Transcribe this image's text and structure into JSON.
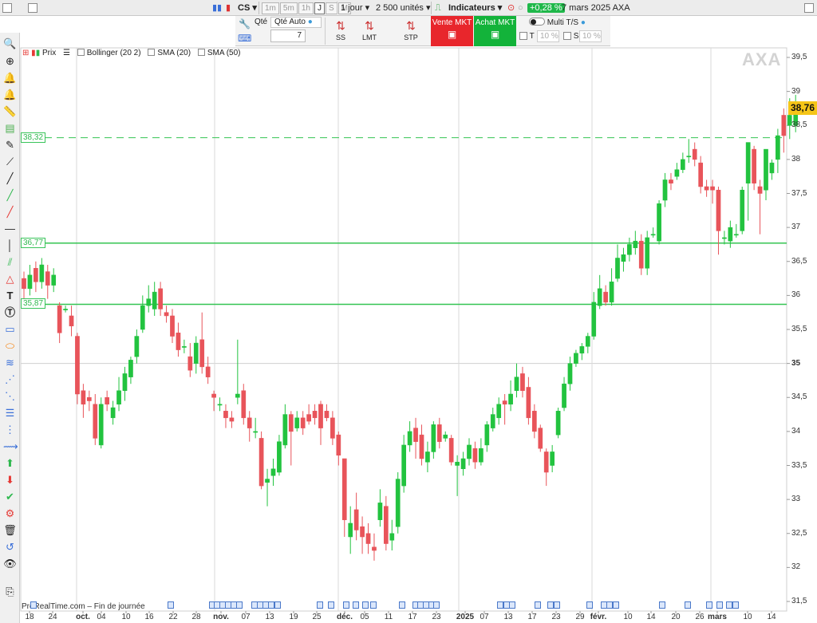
{
  "toolbar": {
    "instrument_code": "CS",
    "timeframes": [
      "1m",
      "5m",
      "1h",
      "J",
      "S",
      "M"
    ],
    "active_timeframe": "J",
    "period": "1 jour",
    "units": "2 500 unités",
    "indicators_label": "Indicateurs",
    "change": "+0,28 %",
    "date_instrument": "7 mars 2025 AXA"
  },
  "order_panel": {
    "qty_label": "Qté",
    "qty_auto": "Qté Auto",
    "qty_value": "7",
    "order_types": [
      "SS",
      "LMT",
      "STP"
    ],
    "sell_label": "Vente MKT",
    "buy_label": "Achat MKT",
    "multi_label": "Multi T/S",
    "t_label": "T",
    "s_label": "S",
    "t_pct": "10",
    "s_pct": "10",
    "pct_sign": "%"
  },
  "legend": {
    "price": "Prix",
    "bollinger": "Bollinger (20 2)",
    "sma20": "SMA (20)",
    "sma50": "SMA (50)"
  },
  "watermark": "AXA",
  "last_price_label": "38,76",
  "levels": [
    {
      "label": "38,32",
      "value": 38.32,
      "style": "dashed"
    },
    {
      "label": "36,77",
      "value": 36.77,
      "style": "solid"
    },
    {
      "label": "35,87",
      "value": 35.87,
      "style": "solid"
    }
  ],
  "footer_source": "ProRealTime.com – Fin de journée",
  "colors": {
    "up": "#22c33f",
    "down": "#e8545a",
    "level": "#34c452",
    "price_tag": "#f5c518"
  },
  "chart_data": {
    "type": "candlestick",
    "instrument": "AXA",
    "ylim": [
      31.5,
      39.5
    ],
    "y_ticks": [
      "31,5",
      "32",
      "32,5",
      "33",
      "33,5",
      "34",
      "34,5",
      "35",
      "35,5",
      "36",
      "36,5",
      "37",
      "37,5",
      "38",
      "38,5",
      "39",
      "39,5"
    ],
    "y_tick_values": [
      31.5,
      32,
      32.5,
      33,
      33.5,
      34,
      34.5,
      35,
      35.5,
      36,
      36.5,
      37,
      37.5,
      38,
      38.5,
      39,
      39.5
    ],
    "x_ticks": [
      "18",
      "24",
      "oct.",
      "04",
      "10",
      "16",
      "22",
      "28",
      "nov.",
      "07",
      "13",
      "19",
      "25",
      "déc.",
      "05",
      "11",
      "17",
      "23",
      "2025",
      "07",
      "13",
      "17",
      "23",
      "29",
      "févr.",
      "10",
      "14",
      "20",
      "26",
      "mars",
      "10",
      "14"
    ],
    "major_ticks": [
      "oct.",
      "nov.",
      "déc.",
      "2025",
      "févr.",
      "mars"
    ],
    "candles": [
      [
        36.25,
        36.1,
        36.35,
        35.95
      ],
      [
        36.1,
        36.3,
        36.45,
        36.0
      ],
      [
        36.4,
        36.2,
        36.5,
        36.05
      ],
      [
        36.2,
        36.45,
        36.55,
        36.1
      ],
      [
        36.35,
        36.15,
        36.45,
        35.95
      ],
      [
        36.15,
        36.3,
        36.4,
        36.05
      ],
      [
        35.85,
        35.45,
        35.9,
        35.3
      ],
      [
        35.8,
        35.8,
        35.85,
        35.75
      ],
      [
        35.7,
        35.55,
        35.85,
        35.4
      ],
      [
        35.4,
        34.55,
        35.45,
        34.4
      ],
      [
        34.6,
        34.4,
        34.7,
        34.2
      ],
      [
        34.5,
        34.45,
        34.6,
        34.3
      ],
      [
        34.4,
        33.9,
        34.55,
        33.8
      ],
      [
        33.8,
        34.4,
        34.5,
        33.75
      ],
      [
        34.5,
        34.4,
        34.6,
        34.3
      ],
      [
        34.2,
        34.35,
        34.45,
        34.1
      ],
      [
        34.4,
        34.6,
        34.8,
        34.3
      ],
      [
        34.6,
        34.85,
        34.95,
        34.45
      ],
      [
        34.8,
        35.05,
        35.1,
        34.7
      ],
      [
        35.1,
        35.4,
        35.5,
        35.0
      ],
      [
        35.5,
        35.85,
        36.0,
        35.45
      ],
      [
        35.85,
        35.95,
        36.15,
        35.75
      ],
      [
        35.8,
        36.05,
        36.2,
        35.7
      ],
      [
        36.1,
        35.8,
        36.2,
        35.7
      ],
      [
        35.75,
        35.7,
        35.85,
        35.6
      ],
      [
        35.7,
        35.4,
        35.8,
        35.3
      ],
      [
        35.45,
        35.2,
        35.6,
        35.1
      ],
      [
        35.25,
        35.25,
        35.35,
        35.15
      ],
      [
        35.1,
        34.9,
        35.3,
        34.8
      ],
      [
        35.0,
        35.3,
        35.4,
        34.85
      ],
      [
        35.35,
        34.95,
        35.75,
        34.85
      ],
      [
        34.95,
        34.8,
        35.1,
        34.7
      ],
      [
        34.55,
        34.5,
        34.6,
        34.3
      ],
      [
        34.4,
        34.4,
        34.5,
        34.3
      ],
      [
        34.3,
        34.2,
        34.4,
        34.05
      ],
      [
        34.2,
        34.15,
        34.3,
        34.05
      ],
      [
        34.5,
        34.55,
        35.35,
        34.4
      ],
      [
        34.6,
        34.2,
        34.7,
        34.1
      ],
      [
        34.2,
        34.05,
        34.3,
        33.85
      ],
      [
        34.0,
        34.0,
        34.2,
        33.9
      ],
      [
        33.9,
        33.2,
        34.0,
        33.15
      ],
      [
        33.25,
        33.3,
        33.45,
        32.9
      ],
      [
        33.35,
        33.45,
        33.6,
        33.2
      ],
      [
        33.4,
        33.85,
        33.95,
        33.35
      ],
      [
        33.8,
        34.25,
        34.4,
        33.75
      ],
      [
        34.25,
        34.0,
        34.3,
        33.5
      ],
      [
        34.05,
        34.2,
        34.3,
        34.0
      ],
      [
        34.2,
        34.05,
        34.3,
        33.95
      ],
      [
        34.25,
        34.15,
        34.4,
        34.1
      ],
      [
        34.3,
        34.2,
        34.4,
        34.1
      ],
      [
        34.4,
        34.05,
        34.45,
        33.8
      ],
      [
        34.3,
        34.2,
        34.4,
        34.15
      ],
      [
        34.2,
        33.9,
        34.3,
        33.8
      ],
      [
        33.95,
        33.65,
        34.0,
        33.5
      ],
      [
        33.6,
        32.7,
        33.6,
        32.45
      ],
      [
        32.45,
        32.65,
        32.9,
        32.2
      ],
      [
        32.85,
        32.55,
        33.1,
        32.4
      ],
      [
        32.6,
        32.45,
        32.75,
        32.2
      ],
      [
        32.5,
        32.35,
        32.65,
        32.2
      ],
      [
        32.3,
        32.25,
        32.5,
        32.1
      ],
      [
        32.7,
        32.95,
        33.15,
        32.6
      ],
      [
        32.9,
        32.35,
        33.05,
        32.25
      ],
      [
        32.4,
        32.5,
        32.7,
        32.25
      ],
      [
        32.6,
        33.3,
        33.4,
        32.5
      ],
      [
        33.2,
        33.8,
        33.95,
        33.1
      ],
      [
        33.8,
        34.0,
        34.15,
        33.7
      ],
      [
        34.05,
        33.85,
        34.2,
        33.6
      ],
      [
        33.95,
        33.6,
        34.1,
        33.5
      ],
      [
        33.55,
        33.7,
        33.85,
        33.4
      ],
      [
        33.7,
        34.1,
        34.15,
        33.6
      ],
      [
        34.1,
        33.85,
        34.2,
        33.75
      ],
      [
        33.9,
        33.95,
        34.0,
        33.85
      ],
      [
        33.9,
        33.55,
        33.95,
        33.5
      ],
      [
        33.5,
        33.55,
        33.65,
        33.05
      ],
      [
        33.45,
        33.6,
        33.7,
        33.35
      ],
      [
        33.6,
        33.8,
        33.9,
        33.5
      ],
      [
        33.75,
        33.55,
        33.85,
        33.45
      ],
      [
        33.55,
        33.75,
        33.9,
        33.5
      ],
      [
        33.8,
        34.1,
        34.15,
        33.7
      ],
      [
        34.05,
        34.25,
        34.35,
        34.0
      ],
      [
        34.2,
        34.4,
        34.5,
        34.1
      ],
      [
        34.45,
        34.4,
        34.55,
        34.1
      ],
      [
        34.4,
        34.55,
        34.75,
        34.3
      ],
      [
        34.6,
        34.8,
        35.0,
        34.5
      ],
      [
        34.85,
        34.6,
        34.95,
        34.5
      ],
      [
        34.65,
        34.2,
        34.8,
        34.1
      ],
      [
        34.3,
        34.0,
        34.4,
        33.9
      ],
      [
        34.05,
        33.75,
        34.1,
        33.7
      ],
      [
        33.7,
        33.4,
        33.75,
        33.2
      ],
      [
        33.5,
        33.7,
        33.8,
        33.4
      ],
      [
        33.95,
        34.3,
        34.35,
        33.9
      ],
      [
        34.35,
        34.7,
        34.8,
        34.3
      ],
      [
        34.7,
        35.0,
        35.1,
        34.6
      ],
      [
        35.0,
        35.15,
        35.2,
        34.95
      ],
      [
        35.15,
        35.25,
        35.3,
        35.05
      ],
      [
        35.25,
        35.4,
        35.45,
        35.15
      ],
      [
        35.4,
        35.9,
        36.05,
        35.35
      ],
      [
        35.85,
        36.1,
        36.3,
        35.8
      ],
      [
        36.05,
        35.9,
        36.15,
        35.85
      ],
      [
        35.9,
        36.2,
        36.4,
        35.85
      ],
      [
        36.25,
        36.55,
        36.75,
        36.2
      ],
      [
        36.5,
        36.6,
        36.7,
        36.35
      ],
      [
        36.6,
        36.75,
        36.85,
        36.5
      ],
      [
        36.7,
        36.8,
        36.95,
        36.6
      ],
      [
        36.8,
        36.4,
        36.9,
        36.3
      ],
      [
        36.4,
        36.85,
        36.95,
        36.3
      ],
      [
        36.9,
        36.9,
        37.0,
        36.85
      ],
      [
        36.8,
        37.35,
        37.4,
        36.75
      ],
      [
        37.4,
        37.7,
        37.8,
        37.3
      ],
      [
        37.7,
        37.65,
        37.8,
        37.55
      ],
      [
        37.75,
        37.85,
        37.95,
        37.7
      ],
      [
        37.85,
        38.0,
        38.1,
        37.8
      ],
      [
        38.05,
        38.05,
        38.3,
        37.95
      ],
      [
        38.15,
        38.0,
        38.25,
        37.9
      ],
      [
        37.95,
        37.6,
        38.05,
        37.5
      ],
      [
        37.6,
        37.55,
        37.7,
        37.45
      ],
      [
        37.6,
        37.55,
        37.7,
        37.35
      ],
      [
        37.55,
        36.95,
        37.6,
        36.6
      ],
      [
        36.85,
        36.85,
        36.95,
        36.75
      ],
      [
        36.8,
        37.0,
        37.1,
        36.7
      ],
      [
        36.9,
        36.9,
        37.05,
        36.85
      ],
      [
        36.95,
        37.55,
        37.6,
        36.9
      ],
      [
        37.65,
        38.25,
        38.25,
        37.1
      ],
      [
        38.15,
        37.65,
        38.2,
        37.55
      ],
      [
        37.6,
        37.5,
        37.7,
        36.9
      ],
      [
        37.55,
        38.15,
        38.15,
        37.4
      ],
      [
        37.8,
        37.95,
        38.0,
        37.7
      ],
      [
        38.0,
        38.35,
        38.45,
        37.8
      ],
      [
        38.65,
        38.35,
        38.75,
        38.1
      ],
      [
        38.5,
        38.65,
        38.9,
        38.3
      ],
      [
        38.5,
        38.76,
        38.95,
        38.4
      ]
    ]
  }
}
